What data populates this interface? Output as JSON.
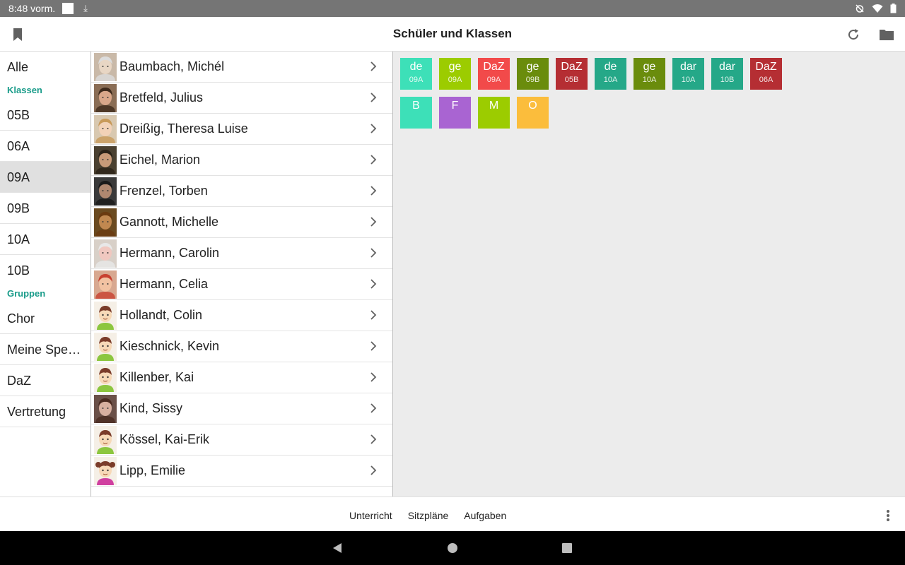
{
  "status": {
    "time": "8:48 vorm."
  },
  "appbar": {
    "title": "Schüler und Klassen",
    "left_icon": "bookmark-icon",
    "right_icons": [
      "refresh-icon",
      "folder-icon"
    ]
  },
  "sidebar": {
    "all_label": "Alle",
    "classes_heading": "Klassen",
    "classes": [
      "05B",
      "06A",
      "09A",
      "09B",
      "10A",
      "10B"
    ],
    "selected": "09A",
    "groups_heading": "Gruppen",
    "groups": [
      "Chor",
      "Meine Spe…",
      "DaZ",
      "Vertretung"
    ]
  },
  "students": [
    {
      "name": "Baumbach, Michél"
    },
    {
      "name": "Bretfeld, Julius"
    },
    {
      "name": "Dreißig, Theresa Luise"
    },
    {
      "name": "Eichel, Marion"
    },
    {
      "name": "Frenzel, Torben"
    },
    {
      "name": "Gannott, Michelle"
    },
    {
      "name": "Hermann, Carolin"
    },
    {
      "name": "Hermann, Celia"
    },
    {
      "name": "Hollandt, Colin"
    },
    {
      "name": "Kieschnick, Kevin"
    },
    {
      "name": "Killenber, Kai"
    },
    {
      "name": "Kind, Sissy"
    },
    {
      "name": "Kössel, Kai-Erik"
    },
    {
      "name": "Lipp, Emilie"
    }
  ],
  "tiles_row1": [
    {
      "subject": "de",
      "class": "09A",
      "color": "#3de0b8"
    },
    {
      "subject": "ge",
      "class": "09A",
      "color": "#9ccc00"
    },
    {
      "subject": "DaZ",
      "class": "09A",
      "color": "#f24a4a"
    },
    {
      "subject": "ge",
      "class": "09B",
      "color": "#6a8c0c"
    },
    {
      "subject": "DaZ",
      "class": "05B",
      "color": "#b52e33"
    },
    {
      "subject": "de",
      "class": "10A",
      "color": "#25a888"
    },
    {
      "subject": "ge",
      "class": "10A",
      "color": "#6a8c0c"
    },
    {
      "subject": "dar",
      "class": "10A",
      "color": "#25a888"
    },
    {
      "subject": "dar",
      "class": "10B",
      "color": "#25a888"
    },
    {
      "subject": "DaZ",
      "class": "06A",
      "color": "#b52e33"
    }
  ],
  "tiles_row2": [
    {
      "subject": "B",
      "color": "#3de0b8"
    },
    {
      "subject": "F",
      "color": "#a964d2"
    },
    {
      "subject": "M",
      "color": "#9ccc00"
    },
    {
      "subject": "O",
      "color": "#fbbd3c"
    }
  ],
  "bottombar": {
    "tabs": [
      "Unterricht",
      "Sitzpläne",
      "Aufgaben"
    ],
    "more_icon": "more-vert-icon"
  },
  "navbar": {
    "icons": [
      "back-icon",
      "home-icon",
      "recents-icon"
    ]
  }
}
